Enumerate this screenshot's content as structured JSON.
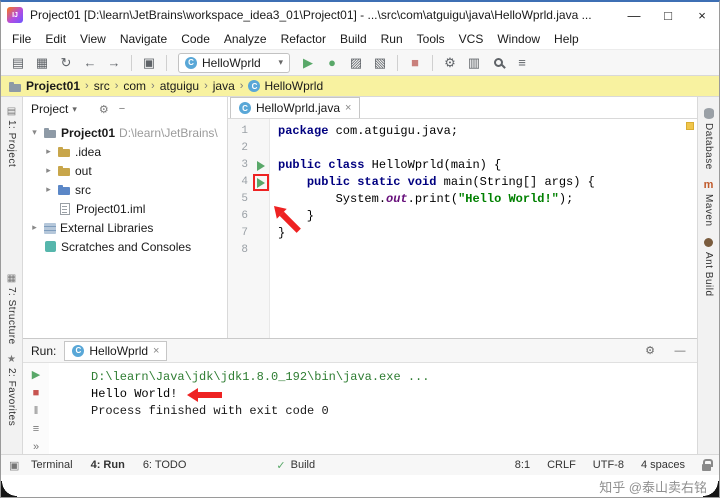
{
  "window": {
    "title": "Project01 [D:\\learn\\JetBrains\\workspace_idea3_01\\Project01] - ...\\src\\com\\atguigu\\java\\HelloWprld.java ...",
    "logo": "IJ",
    "controls": {
      "minimize": "—",
      "maximize": "□",
      "close": "×"
    }
  },
  "icons": {
    "class_letter": "C"
  },
  "menu": {
    "items": [
      "File",
      "Edit",
      "View",
      "Navigate",
      "Code",
      "Analyze",
      "Refactor",
      "Build",
      "Run",
      "Tools",
      "VCS",
      "Window",
      "Help"
    ]
  },
  "toolbar": {
    "items": [
      {
        "t": "icon",
        "name": "open-icon",
        "g": "▤"
      },
      {
        "t": "icon",
        "name": "save-all-icon",
        "g": "▦"
      },
      {
        "t": "icon",
        "name": "sync-icon",
        "g": "↻"
      },
      {
        "t": "icon",
        "name": "back-icon",
        "g": "←"
      },
      {
        "t": "icon",
        "name": "forward-icon",
        "g": "→"
      },
      {
        "t": "sep"
      },
      {
        "t": "icon",
        "name": "editor-config-icon",
        "g": "▣"
      },
      {
        "t": "sep"
      },
      {
        "t": "combo",
        "name": "run-config-select",
        "label": "HelloWprld",
        "chevron": "▾"
      },
      {
        "t": "icon",
        "name": "run-button",
        "g": "▶",
        "c": "#59a869"
      },
      {
        "t": "icon",
        "name": "debug-bug-button",
        "g": "●",
        "c": "#59a869"
      },
      {
        "t": "icon",
        "name": "coverage-button",
        "g": "▨"
      },
      {
        "t": "icon",
        "name": "profiler-button",
        "g": "▧"
      },
      {
        "t": "sep"
      },
      {
        "t": "icon",
        "name": "stop-button",
        "g": "■",
        "c": "#c9807c"
      },
      {
        "t": "sep"
      },
      {
        "t": "icon",
        "name": "wrench-icon",
        "g": "⚙"
      },
      {
        "t": "icon",
        "name": "project-structure-icon",
        "g": "▥"
      },
      {
        "t": "search",
        "name": "search-icon"
      },
      {
        "t": "icon",
        "name": "tool-windows-icon",
        "g": "≡"
      }
    ]
  },
  "breadcrumb": {
    "separator": "›",
    "items": [
      {
        "label": "Project01",
        "icon": "folder"
      },
      {
        "label": "src",
        "icon": ""
      },
      {
        "label": "com",
        "icon": ""
      },
      {
        "label": "atguigu",
        "icon": ""
      },
      {
        "label": "java",
        "icon": ""
      },
      {
        "label": "HelloWprld",
        "icon": "class"
      }
    ]
  },
  "left_stripe": {
    "top": [
      {
        "name": "toolwindow-project",
        "glyph": "▤",
        "label": "1: Project"
      }
    ],
    "bottom": [
      {
        "name": "toolwindow-structure",
        "glyph": "▦",
        "label": "7: Structure"
      },
      {
        "name": "toolwindow-favorites",
        "glyph": "★",
        "label": "2: Favorites"
      }
    ]
  },
  "right_stripe": {
    "items": [
      {
        "name": "toolwindow-database",
        "cssicon": "ic-db",
        "label": "Database"
      },
      {
        "name": "toolwindow-maven",
        "glyph": "m",
        "mavenletter": true,
        "label": "Maven"
      },
      {
        "name": "toolwindow-antbuild",
        "cssicon": "ic-ant",
        "label": "Ant Build"
      }
    ]
  },
  "project_panel": {
    "header": {
      "title": "Project",
      "chevron": "▾",
      "icons": [
        {
          "name": "gear-icon",
          "g": "⚙"
        },
        {
          "name": "collapse-all-icon",
          "g": "−"
        }
      ]
    },
    "tree": [
      {
        "indent": 0,
        "chev": "▾",
        "icon": "project",
        "label": "Project01",
        "suffix": " D:\\learn\\JetBrains\\",
        "bold": true
      },
      {
        "indent": 1,
        "chev": "▸",
        "icon": "folder",
        "label": ".idea"
      },
      {
        "indent": 1,
        "chev": "▸",
        "icon": "folder",
        "label": "out"
      },
      {
        "indent": 1,
        "chev": "▸",
        "icon": "src",
        "label": "src"
      },
      {
        "indent": 1,
        "chev": "",
        "icon": "file",
        "label": "Project01.iml"
      },
      {
        "indent": 0,
        "chev": "▸",
        "icon": "lib",
        "label": "External Libraries"
      },
      {
        "indent": 0,
        "chev": "",
        "icon": "scratch",
        "label": "Scratches and Consoles"
      }
    ]
  },
  "editor": {
    "tab": {
      "label": "HelloWprld.java",
      "close": "×"
    },
    "lines": [
      {
        "n": "1",
        "segs": [
          [
            "package ",
            "kw"
          ],
          [
            "com.atguigu.java;",
            "pl"
          ]
        ]
      },
      {
        "n": "2",
        "segs": []
      },
      {
        "n": "3",
        "run": true,
        "segs": [
          [
            "public class ",
            "kw"
          ],
          [
            "HelloWprld(main) {",
            "pl"
          ]
        ]
      },
      {
        "n": "4",
        "run": true,
        "boxed": true,
        "segs": [
          [
            "    ",
            "pl"
          ],
          [
            "public static void ",
            "kw"
          ],
          [
            "main(String[] args) {",
            "pl"
          ]
        ]
      },
      {
        "n": "5",
        "segs": [
          [
            "        System.",
            "pl"
          ],
          [
            "out",
            "fd"
          ],
          [
            ".print(",
            "pl"
          ],
          [
            "\"Hello World!\"",
            "st"
          ],
          [
            ");",
            "pl"
          ]
        ]
      },
      {
        "n": "6",
        "segs": [
          [
            "    }",
            "pl"
          ]
        ]
      },
      {
        "n": "7",
        "segs": [
          [
            "}",
            "pl"
          ]
        ]
      },
      {
        "n": "8",
        "segs": []
      }
    ]
  },
  "run_panel": {
    "label": "Run:",
    "tab": {
      "label": "HelloWprld",
      "close": "×"
    },
    "right_icons": [
      {
        "name": "gear-icon",
        "g": "⚙"
      },
      {
        "name": "hide-panel-icon",
        "g": "—"
      }
    ],
    "left_icons": [
      {
        "name": "rerun-icon",
        "g": "▶",
        "c": "#59a869"
      },
      {
        "name": "stop-icon",
        "g": "■",
        "c": "#c75450"
      },
      {
        "name": "pause-icon",
        "g": "‖",
        "c": "#777"
      },
      {
        "name": "restore-layout-icon",
        "g": "≡",
        "c": "#777"
      },
      {
        "name": "expand-icon",
        "g": "»",
        "c": "#777"
      }
    ],
    "lines": [
      {
        "text": "D:\\learn\\Java\\jdk\\jdk1.8.0_192\\bin\\java.exe ...",
        "cls": "cmd"
      },
      {
        "text": "Hello World!",
        "cls": "out",
        "arrow": true
      },
      {
        "text": "Process finished with exit code 0",
        "cls": "sys"
      }
    ]
  },
  "statusbar": {
    "switcher": "▣",
    "tabs": [
      {
        "label": "Terminal",
        "active": false
      },
      {
        "label": "4: Run",
        "active": true
      },
      {
        "label": "6: TODO",
        "active": false
      }
    ],
    "build": {
      "icon": "✓",
      "label": "Build"
    },
    "right": [
      "8:1",
      "CRLF",
      "UTF-8",
      "4 spaces"
    ],
    "lock": true
  },
  "watermark": {
    "text": "知乎 @泰山卖右铭"
  },
  "colors": {
    "accent": "#3d6fb4",
    "annotation": "#ee2222",
    "keyword": "#000080",
    "string": "#008000",
    "field": "#660e7a",
    "breadcrumb_bg": "#f8f2a0"
  }
}
